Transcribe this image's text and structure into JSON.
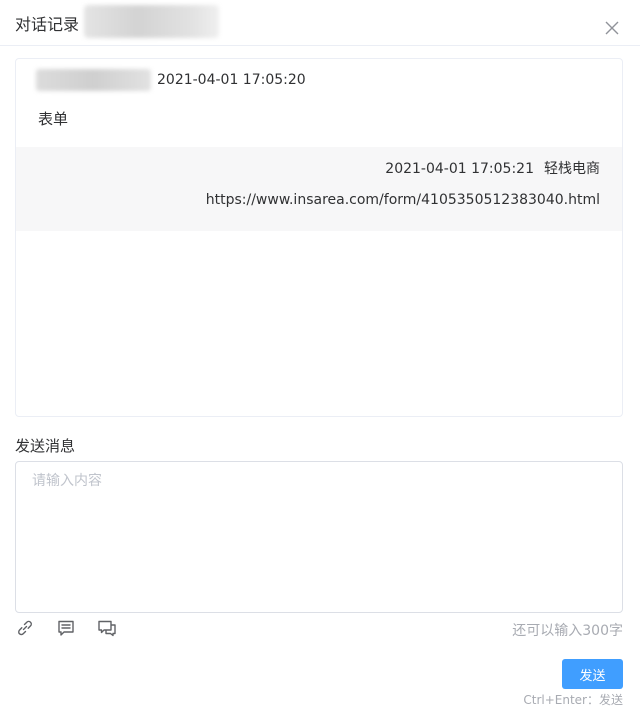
{
  "dialog": {
    "title": "对话记录"
  },
  "messages": [
    {
      "time": "2021-04-01 17:05:20",
      "text": "表单"
    },
    {
      "time": "2021-04-01 17:05:21",
      "sender": "轻栈电商",
      "text": "https://www.insarea.com/form/4105350512383040.html"
    }
  ],
  "composer": {
    "label": "发送消息",
    "placeholder": "请输入内容",
    "counter": "还可以输入300字",
    "tools": [
      "link-icon",
      "comment-icon",
      "chat-icon"
    ],
    "send_label": "发送",
    "shortcut_hint": "Ctrl+Enter：发送"
  },
  "colors": {
    "primary": "#409eff",
    "border": "#dcdfe6",
    "message_bg": "#f7f7f8",
    "placeholder": "#c0c4cc"
  }
}
